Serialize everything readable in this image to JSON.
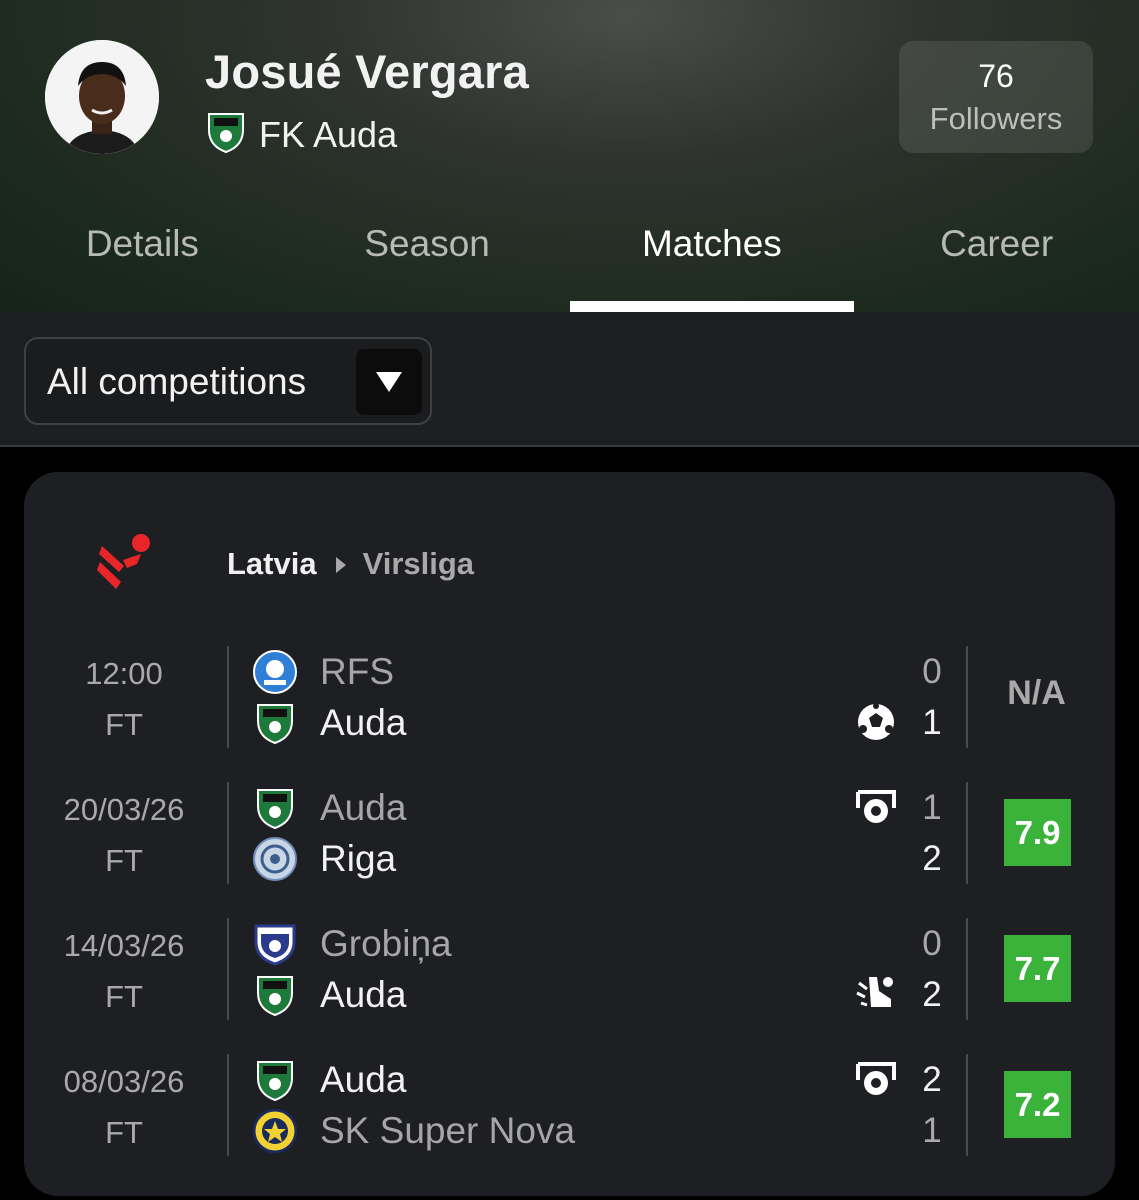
{
  "player": {
    "name": "Josué Vergara",
    "club": "FK Auda",
    "followers_count": "76",
    "followers_label": "Followers"
  },
  "tabs": [
    {
      "label": "Details",
      "active": false
    },
    {
      "label": "Season",
      "active": false
    },
    {
      "label": "Matches",
      "active": true
    },
    {
      "label": "Career",
      "active": false
    }
  ],
  "filter": {
    "selected": "All competitions"
  },
  "competition": {
    "country": "Latvia",
    "league": "Virsliga"
  },
  "matches": [
    {
      "time": "12:00",
      "status": "FT",
      "home": {
        "name": "RFS",
        "score": "0"
      },
      "away": {
        "name": "Auda",
        "score": "1"
      },
      "event": "goal-icon",
      "rating": "N/A"
    },
    {
      "time": "20/03/26",
      "status": "FT",
      "home": {
        "name": "Auda",
        "score": "1"
      },
      "away": {
        "name": "Riga",
        "score": "2"
      },
      "event": "goal-net-icon",
      "rating": "7.9"
    },
    {
      "time": "14/03/26",
      "status": "FT",
      "home": {
        "name": "Grobiņa",
        "score": "0"
      },
      "away": {
        "name": "Auda",
        "score": "2"
      },
      "event": "assist-boot-icon",
      "rating": "7.7"
    },
    {
      "time": "08/03/26",
      "status": "FT",
      "home": {
        "name": "Auda",
        "score": "2"
      },
      "away": {
        "name": "SK Super Nova",
        "score": "1"
      },
      "event": "goal-net-icon",
      "rating": "7.2"
    }
  ],
  "colors": {
    "rating_green": "#3bb33b",
    "card_bg": "#1e1f22",
    "brand_red": "#e8262a"
  }
}
